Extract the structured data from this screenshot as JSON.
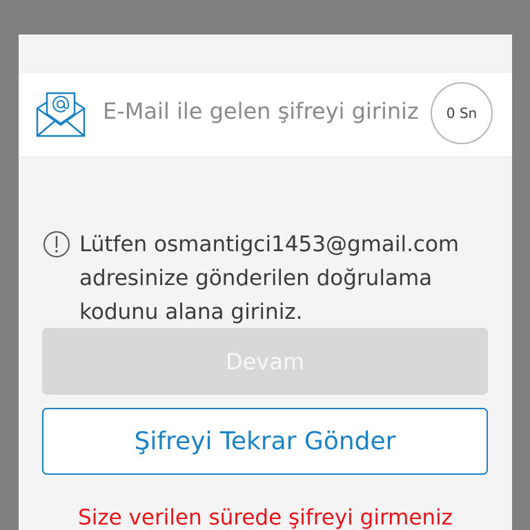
{
  "header": {
    "title": "E-Mail ile gelen şifreyi giriniz",
    "timer": "0 Sn",
    "icon": "email-envelope-icon"
  },
  "info": {
    "icon": "exclamation-circle-icon",
    "message": "Lütfen osmantigci1453@gmail.com adresinize gönderilen doğrulama kodunu alana giriniz."
  },
  "buttons": {
    "continue_label": "Devam",
    "resend_label": "Şifreyi Tekrar Gönder"
  },
  "warning": {
    "text": "Size verilen sürede şifreyi girmeniz"
  },
  "colors": {
    "accent": "#1b82c5",
    "warning": "#e8151b",
    "disabled_button": "#d8d8d8"
  }
}
